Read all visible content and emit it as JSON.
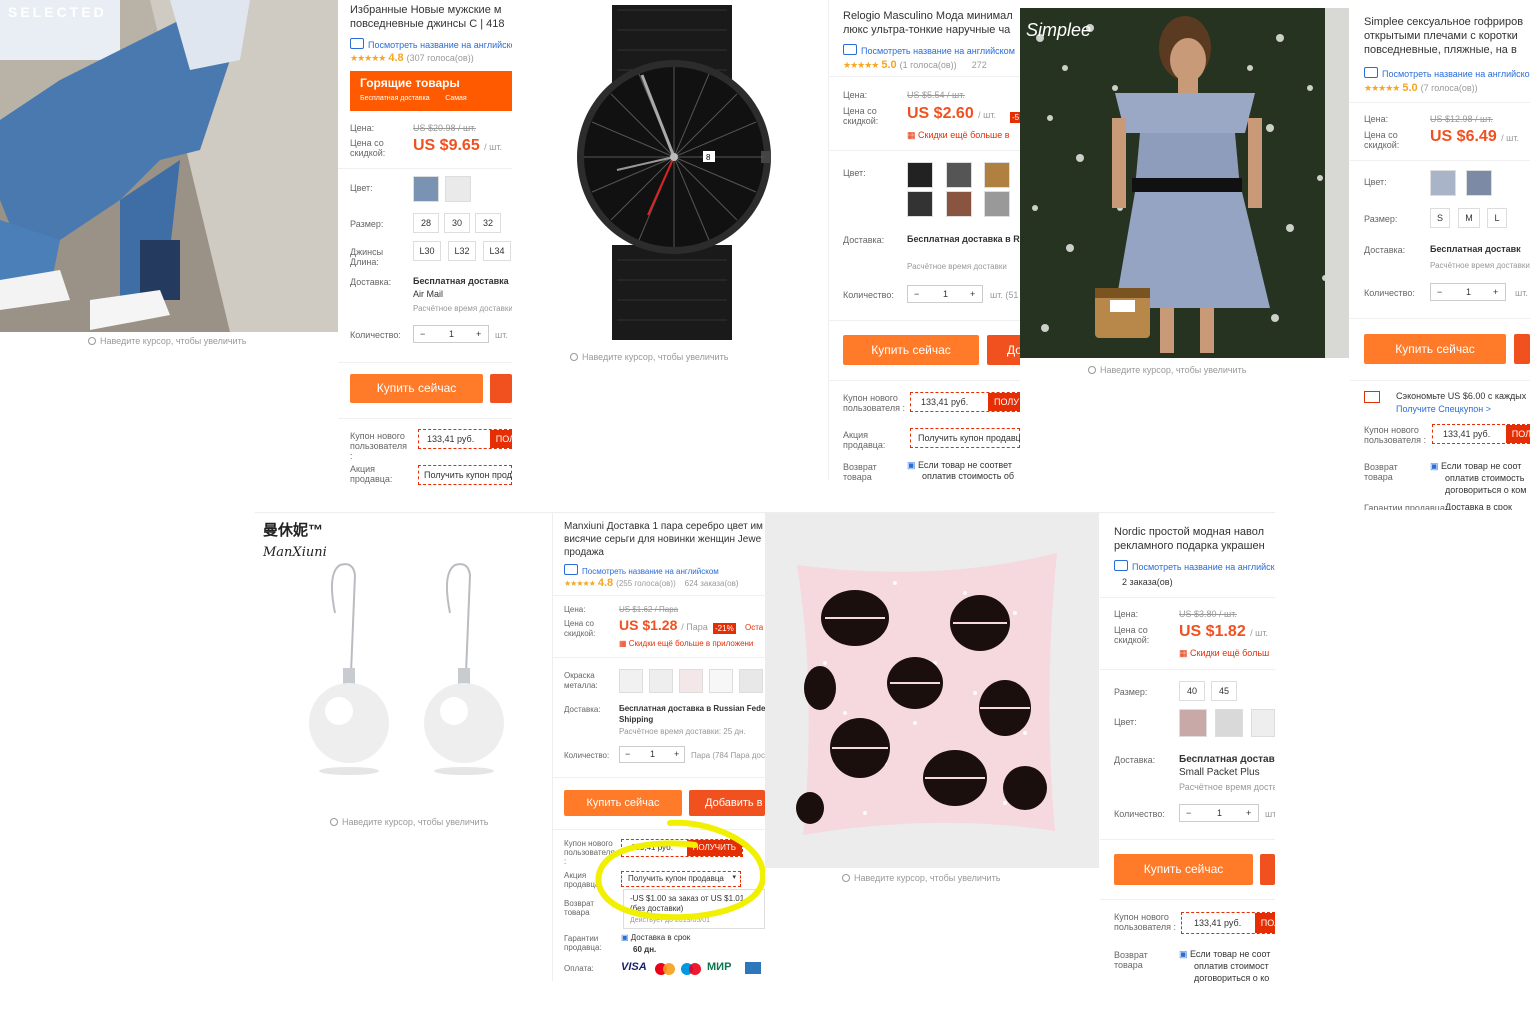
{
  "zoom_hint": "Наведите курсор, чтобы увеличить",
  "translate_link": "Посмотреть название на английском",
  "labels": {
    "price": "Цена:",
    "discount_price": "Цена со скидкой:",
    "color": "Цвет:",
    "size": "Размер:",
    "jeans_length": "Джинсы Длина:",
    "delivery": "Доставка:",
    "quantity": "Количество:",
    "new_user_coupon": "Купон нового пользователя :",
    "seller_promo": "Акция продавца:",
    "return": "Возврат товара",
    "guarantee": "Гарантии продавца:",
    "payment": "Оплата:",
    "metal": "Окраска металла:"
  },
  "buy_now": "Купить сейчас",
  "add_to_cart": "Добавить в",
  "coupon_value": "133,41 руб.",
  "get": "ПОЛУЧИТЬ",
  "get_seller_coupon": "Получить купон продавца",
  "more_discounts": "Скидки ещё больше в",
  "delivery_estimate": "Расчётное время доставки",
  "free_shipping": "Бесплатная доставка",
  "products": {
    "jeans": {
      "brand_logo": "SELECTED",
      "title1": "Избранные Новые мужские м",
      "title2": "повседневные джинсы C | 418",
      "rating": "4.8",
      "votes": "(307 голоса(ов))",
      "hot_title": "Горящие товары",
      "hot_sub1": "Бесплатная доставка",
      "hot_sub2": "Самая",
      "old_price": "US $20.98 / шт.",
      "price": "US $9.65",
      "unit": "/ шт.",
      "sizes": [
        "28",
        "30",
        "32"
      ],
      "lengths": [
        "L30",
        "L32",
        "L34"
      ],
      "shipping": "Бесплатная доставка",
      "method": "Air Mail",
      "qty": "1",
      "qty_unit": "шт."
    },
    "watch": {
      "title1": "Relogio Masculino Мода минимал",
      "title2": "люкс ультра-тонкие наручные ча",
      "rating": "5.0",
      "votes": "(1 голоса(ов))",
      "orders": "272",
      "old_price": "US $5.54 / шт.",
      "price": "US $2.60",
      "unit": "/ шт.",
      "discount_badge": "-5",
      "shipping": "Бесплатная доставка в R",
      "qty": "1",
      "qty_unit": "шт. (51"
    },
    "dress": {
      "brand_logo": "Simplee",
      "title1": "Simplee сексуальное гофриров",
      "title2": "открытыми плечами с коротки",
      "title3": "повседневные, пляжные, на в",
      "rating": "5.0",
      "votes": "(7 голоса(ов))",
      "old_price": "US $12.98 / шт.",
      "price": "US $6.49",
      "unit": "/ шт.",
      "sizes": [
        "S",
        "M",
        "L"
      ],
      "shipping": "Бесплатная доставк",
      "save_text": "Сэкономьте US $6.00 с каждых",
      "save_link": "Получите Спецкупон >",
      "return_text1": "Если товар не соот",
      "return_text2": "оплатив стоимость",
      "return_text3": "договориться о ком",
      "guarantee_text": "Доставка в срок",
      "qty": "1",
      "qty_unit": "шт."
    },
    "earrings": {
      "brand_logo": "ManXiuni",
      "title1": "Manxiuni Доставка 1 пара серебро цвет им",
      "title2": "висячие серьги для новинки женщин Jewe",
      "title3": "продажа",
      "rating": "4.8",
      "votes": "(255 голоса(ов))",
      "orders": "624 заказа(ов)",
      "old_price": "US $1.62 / Пара",
      "price": "US $1.28",
      "unit": "/ Пара",
      "discount_badge": "-21%",
      "ost": "Оста",
      "more_app": "Скидки ещё больше в приложени",
      "shipping": "Бесплатная доставка в Russian Fede",
      "method": "Shipping",
      "delivery_days": "Расчётное время доставки: 25 дн.",
      "qty": "1",
      "qty_unit": "Пара (784 Пара дос",
      "promo_line1": "-US $1.00 за заказ от US $1.01",
      "promo_line2": "(без доставки)",
      "promo_valid": "Действует до 2019/05/01",
      "guarantee_text": "Доставка в срок",
      "guarantee_days": "60 дн.",
      "payment_methods": [
        "VISA",
        "MC",
        "Maestro",
        "МИР",
        "AMEX"
      ]
    },
    "pillow": {
      "title1": "Nordic простой модная навол",
      "title2": "рекламного подарка украшен",
      "orders": "2 заказа(ов)",
      "old_price": "US $3.80 / шт.",
      "price": "US $1.82",
      "unit": "/ шт.",
      "more": "Скидки ещё больш",
      "sizes": [
        "40",
        "45"
      ],
      "shipping": "Бесплатная доставка",
      "method": "Small Packet Plus",
      "return_text1": "Если товар не соот",
      "return_text2": "оплатив стоимост",
      "return_text3": "договориться о ко",
      "qty": "1",
      "qty_unit": "шт"
    }
  },
  "colors": {
    "accent": "#f0511f",
    "buy_button": "#ff7a29",
    "coupon_red": "#e62e04",
    "link_blue": "#2a6dd7",
    "highlight_yellow": "#f0f000",
    "pillow_bg": "#f6d9df"
  }
}
